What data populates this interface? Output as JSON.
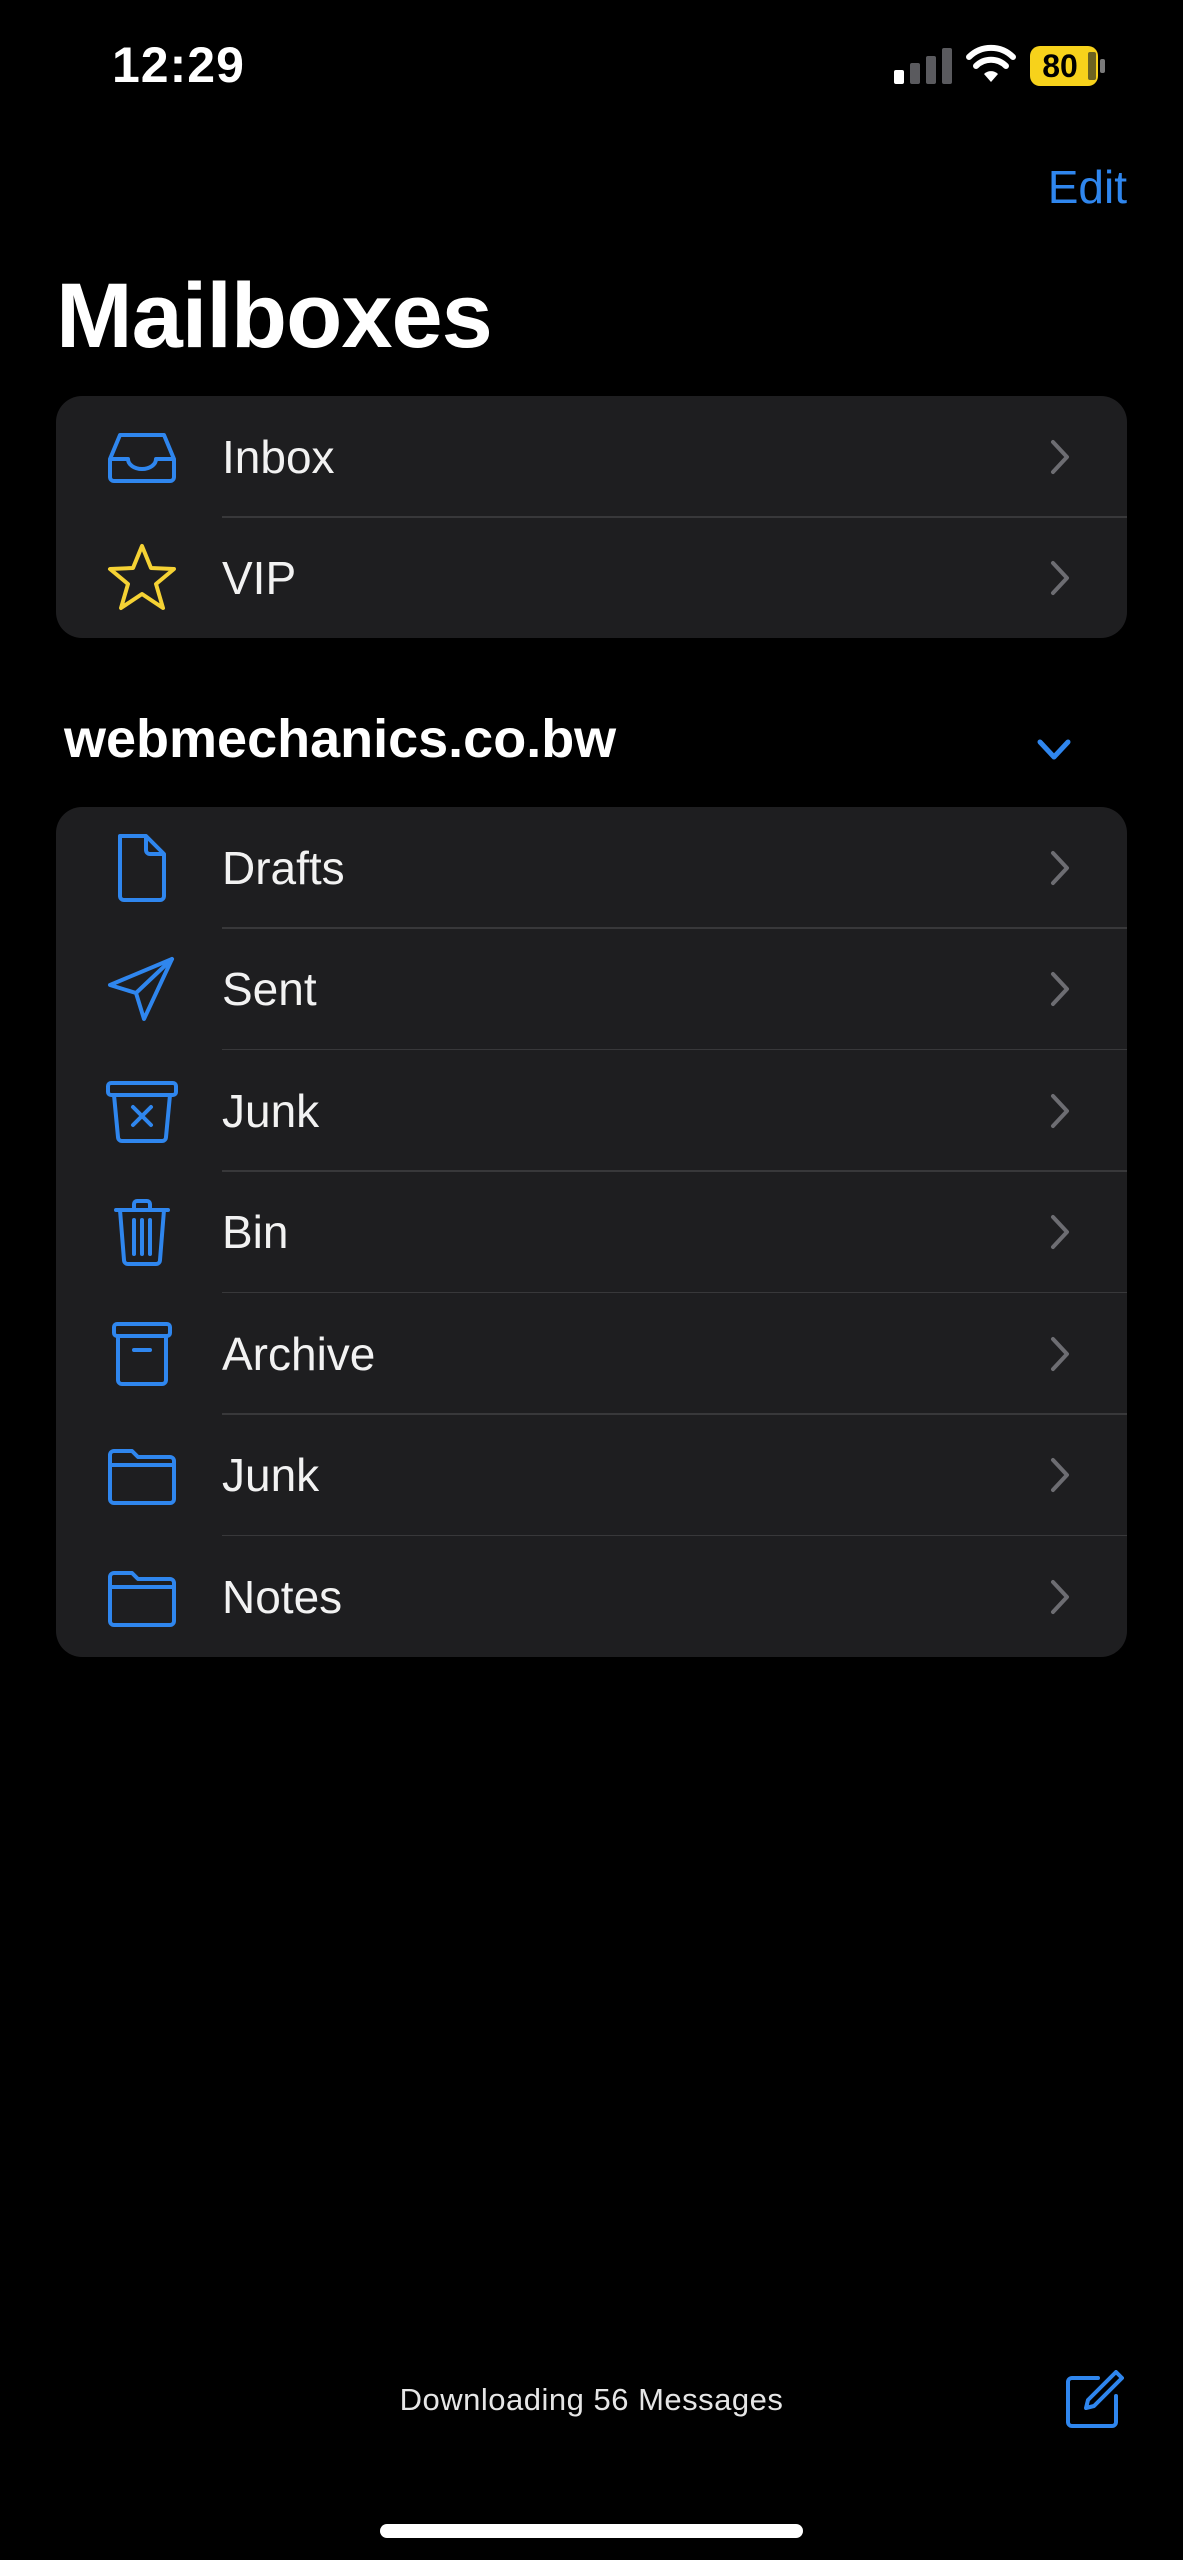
{
  "status_bar": {
    "time": "12:29",
    "battery_level": "80",
    "battery_color": "#f7d21b",
    "icons": [
      "cellular-signal-icon",
      "wifi-icon",
      "battery-icon"
    ]
  },
  "nav": {
    "edit_label": "Edit"
  },
  "page": {
    "title": "Mailboxes"
  },
  "favorites": [
    {
      "label": "Inbox",
      "icon": "inbox-tray-icon"
    },
    {
      "label": "VIP",
      "icon": "star-icon"
    }
  ],
  "account": {
    "name": "webmechanics.co.bw",
    "expanded": true,
    "mailboxes": [
      {
        "label": "Drafts",
        "icon": "document-icon"
      },
      {
        "label": "Sent",
        "icon": "paper-plane-icon"
      },
      {
        "label": "Junk",
        "icon": "junk-bin-icon"
      },
      {
        "label": "Bin",
        "icon": "trash-icon"
      },
      {
        "label": "Archive",
        "icon": "archive-box-icon"
      },
      {
        "label": "Junk",
        "icon": "folder-icon"
      },
      {
        "label": "Notes",
        "icon": "folder-icon"
      }
    ]
  },
  "toolbar": {
    "status_text": "Downloading 56 Messages",
    "compose_icon": "compose-icon"
  },
  "colors": {
    "accent": "#2f86ee",
    "vip_star": "#f5d234",
    "background": "#000000",
    "group_background": "#1e1e20"
  }
}
